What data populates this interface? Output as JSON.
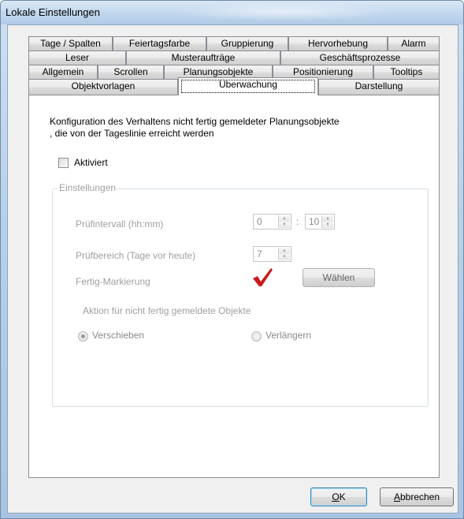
{
  "window": {
    "title": "Lokale Einstellungen"
  },
  "tabs": {
    "row1": [
      "Tage / Spalten",
      "Feiertagsfarbe",
      "Gruppierung",
      "Hervorhebung",
      "Alarm"
    ],
    "row2": [
      "Leser",
      "Musteraufträge",
      "Geschäftsprozesse"
    ],
    "row3": [
      "Allgemein",
      "Scrollen",
      "Planungsobjekte",
      "Positionierung",
      "Tooltips"
    ],
    "row4": [
      "Objektvorlagen",
      "Überwachung",
      "Darstellung"
    ],
    "active": "Überwachung"
  },
  "panel": {
    "description_line1": "Konfiguration des Verhaltens nicht fertig gemeldeter Planungsobjekte",
    "description_line2": ", die von der Tageslinie erreicht werden",
    "enabled_checkbox": {
      "label": "Aktiviert",
      "checked": false
    },
    "group": {
      "title": "Einstellungen",
      "interval_label": "Prüfintervall (hh:mm)",
      "interval_hours": "0",
      "interval_separator": ":",
      "interval_minutes": "10",
      "range_label": "Prüfbereich (Tage vor heute)",
      "range_value": "7",
      "done_marker_label": "Fertig-Markierung",
      "done_marker_icon": "checkmark-icon",
      "choose_button": "Wählen",
      "action_label": "Aktion für nicht fertig gemeldete Objekte",
      "radio_move": {
        "label": "Verschieben",
        "selected": true
      },
      "radio_extend": {
        "label": "Verlängern",
        "selected": false
      }
    }
  },
  "buttons": {
    "ok_underline": "O",
    "ok_rest": "K",
    "cancel_underline": "A",
    "cancel_rest": "bbrechen"
  },
  "colors": {
    "checkmark": "#cc1a1a",
    "title_bar": "#c3d8ee",
    "disabled_text": "#a0a0a0"
  }
}
